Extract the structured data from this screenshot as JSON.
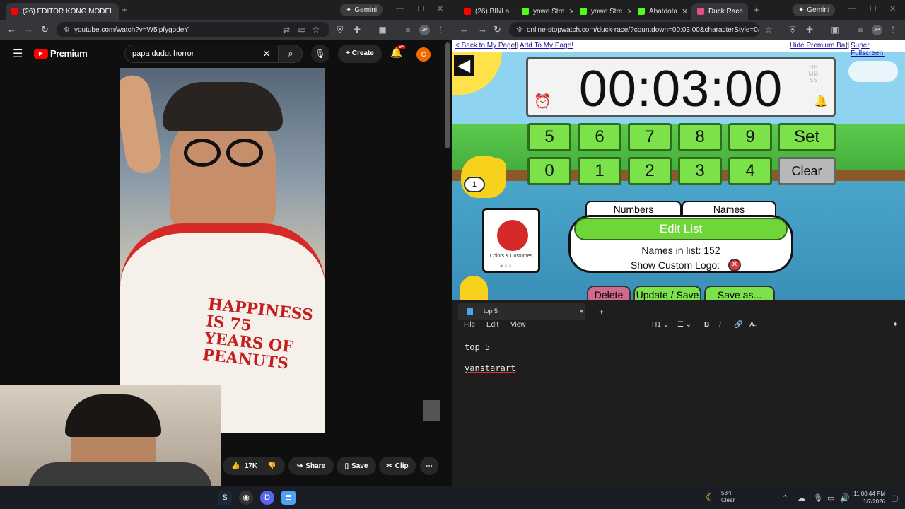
{
  "left_browser": {
    "tabs": [
      {
        "title": "(26) EDITOR KONG MODEL",
        "active": true
      }
    ],
    "gemini_label": "Gemini",
    "url": "youtube.com/watch?v=W5lpfygodeY",
    "profile": "JP",
    "youtube": {
      "logo": "Premium",
      "search_value": "papa dudut horror",
      "create_label": "Create",
      "notification_badge": "9+",
      "user_initial": "C",
      "like_count": "17K",
      "share_label": "Share",
      "save_label": "Save",
      "clip_label": "Clip"
    }
  },
  "right_browser": {
    "tabs": [
      {
        "title": "(26) BINI a"
      },
      {
        "title": "yowe Stre"
      },
      {
        "title": "yowe Stre"
      },
      {
        "title": "Abatdota"
      },
      {
        "title": "Duck Race",
        "active": true
      }
    ],
    "gemini_label": "Gemini",
    "url": "online-stopwatch.com/duck-race/?countdown=00:03:00&characterStyle=0&...",
    "profile": "JP",
    "page": {
      "links": {
        "back": "< Back to My Page!",
        "add": "Add To My Page!",
        "hide": "Hide Premium Bar",
        "fullscreen": "Super Fullscreen!"
      },
      "timer": "00:03:00",
      "hms": [
        "HH",
        "MM",
        "SS"
      ],
      "keys_row1": [
        "5",
        "6",
        "7",
        "8",
        "9",
        "Set"
      ],
      "keys_row2": [
        "0",
        "1",
        "2",
        "3",
        "4",
        "Clear"
      ],
      "tab_numbers": "Numbers",
      "tab_names": "Names",
      "edit_list": "Edit List",
      "names_in_list": "Names in list: 152",
      "custom_logo": "Show Custom Logo:",
      "scroll_caption": "Colors & Costumes",
      "duck_number": "1",
      "delete_label": "Delete",
      "update_label": "Update / Save",
      "saveas_label": "Save as..."
    }
  },
  "notepad": {
    "tab_title": "top 5",
    "menu": [
      "File",
      "Edit",
      "View"
    ],
    "heading_select": "H1",
    "lines": [
      "top 5",
      "yanstarart"
    ]
  },
  "taskbar": {
    "weather_temp": "53°F",
    "weather_desc": "Clear",
    "time": "11:00:44 PM",
    "date": "1/7/2026"
  }
}
